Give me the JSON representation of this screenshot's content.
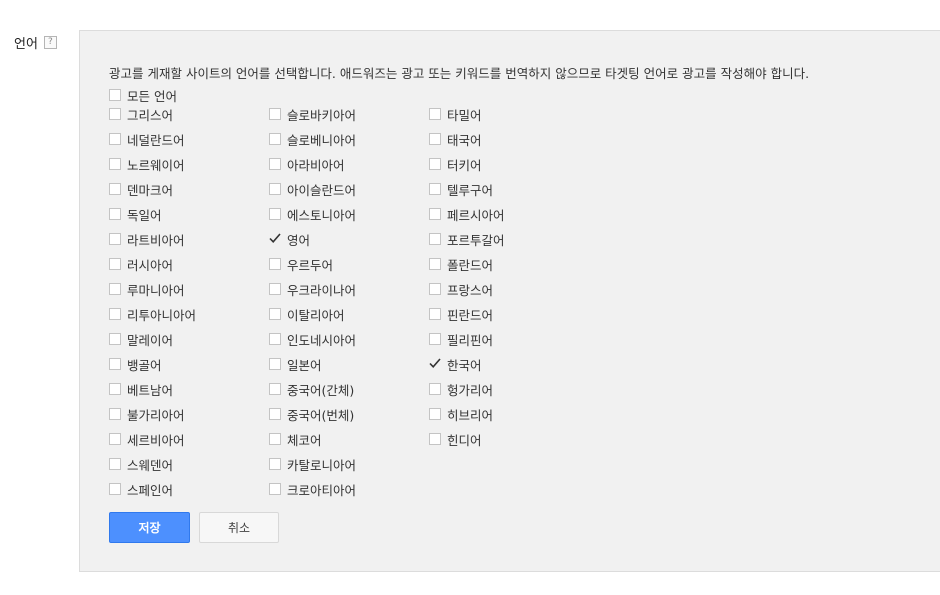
{
  "field": {
    "label": "언어",
    "help": "?"
  },
  "panel": {
    "description": "광고를 게재할 사이트의 언어를 선택합니다. 애드워즈는 광고 또는 키워드를 번역하지 않으므로 타겟팅 언어로 광고를 작성해야 합니다."
  },
  "all_languages": {
    "label": "모든 언어",
    "checked": false
  },
  "columns": [
    [
      {
        "label": "그리스어",
        "checked": false
      },
      {
        "label": "네덜란드어",
        "checked": false
      },
      {
        "label": "노르웨이어",
        "checked": false
      },
      {
        "label": "덴마크어",
        "checked": false
      },
      {
        "label": "독일어",
        "checked": false
      },
      {
        "label": "라트비아어",
        "checked": false
      },
      {
        "label": "러시아어",
        "checked": false
      },
      {
        "label": "루마니아어",
        "checked": false
      },
      {
        "label": "리투아니아어",
        "checked": false
      },
      {
        "label": "말레이어",
        "checked": false
      },
      {
        "label": "뱅골어",
        "checked": false
      },
      {
        "label": "베트남어",
        "checked": false
      },
      {
        "label": "불가리아어",
        "checked": false
      },
      {
        "label": "세르비아어",
        "checked": false
      },
      {
        "label": "스웨덴어",
        "checked": false
      },
      {
        "label": "스페인어",
        "checked": false
      }
    ],
    [
      {
        "label": "슬로바키아어",
        "checked": false
      },
      {
        "label": "슬로베니아어",
        "checked": false
      },
      {
        "label": "아라비아어",
        "checked": false
      },
      {
        "label": "아이슬란드어",
        "checked": false
      },
      {
        "label": "에스토니아어",
        "checked": false
      },
      {
        "label": "영어",
        "checked": true
      },
      {
        "label": "우르두어",
        "checked": false
      },
      {
        "label": "우크라이나어",
        "checked": false
      },
      {
        "label": "이탈리아어",
        "checked": false
      },
      {
        "label": "인도네시아어",
        "checked": false
      },
      {
        "label": "일본어",
        "checked": false
      },
      {
        "label": "중국어(간체)",
        "checked": false
      },
      {
        "label": "중국어(번체)",
        "checked": false
      },
      {
        "label": "체코어",
        "checked": false
      },
      {
        "label": "카탈로니아어",
        "checked": false
      },
      {
        "label": "크로아티아어",
        "checked": false
      }
    ],
    [
      {
        "label": "타밀어",
        "checked": false
      },
      {
        "label": "태국어",
        "checked": false
      },
      {
        "label": "터키어",
        "checked": false
      },
      {
        "label": "텔루구어",
        "checked": false
      },
      {
        "label": "페르시아어",
        "checked": false
      },
      {
        "label": "포르투갈어",
        "checked": false
      },
      {
        "label": "폴란드어",
        "checked": false
      },
      {
        "label": "프랑스어",
        "checked": false
      },
      {
        "label": "핀란드어",
        "checked": false
      },
      {
        "label": "필리핀어",
        "checked": false
      },
      {
        "label": "한국어",
        "checked": true
      },
      {
        "label": "헝가리어",
        "checked": false
      },
      {
        "label": "히브리어",
        "checked": false
      },
      {
        "label": "힌디어",
        "checked": false
      }
    ]
  ],
  "buttons": {
    "save_label": "저장",
    "cancel_label": "취소"
  },
  "colors": {
    "accent": "#4d90fe",
    "panel_bg": "#f1f1f1",
    "checkbox_border": "#c4c4c4"
  },
  "icons": {
    "help": "question-mark-box-icon",
    "checked": "checkmark-icon",
    "unchecked": "empty-checkbox-icon"
  }
}
